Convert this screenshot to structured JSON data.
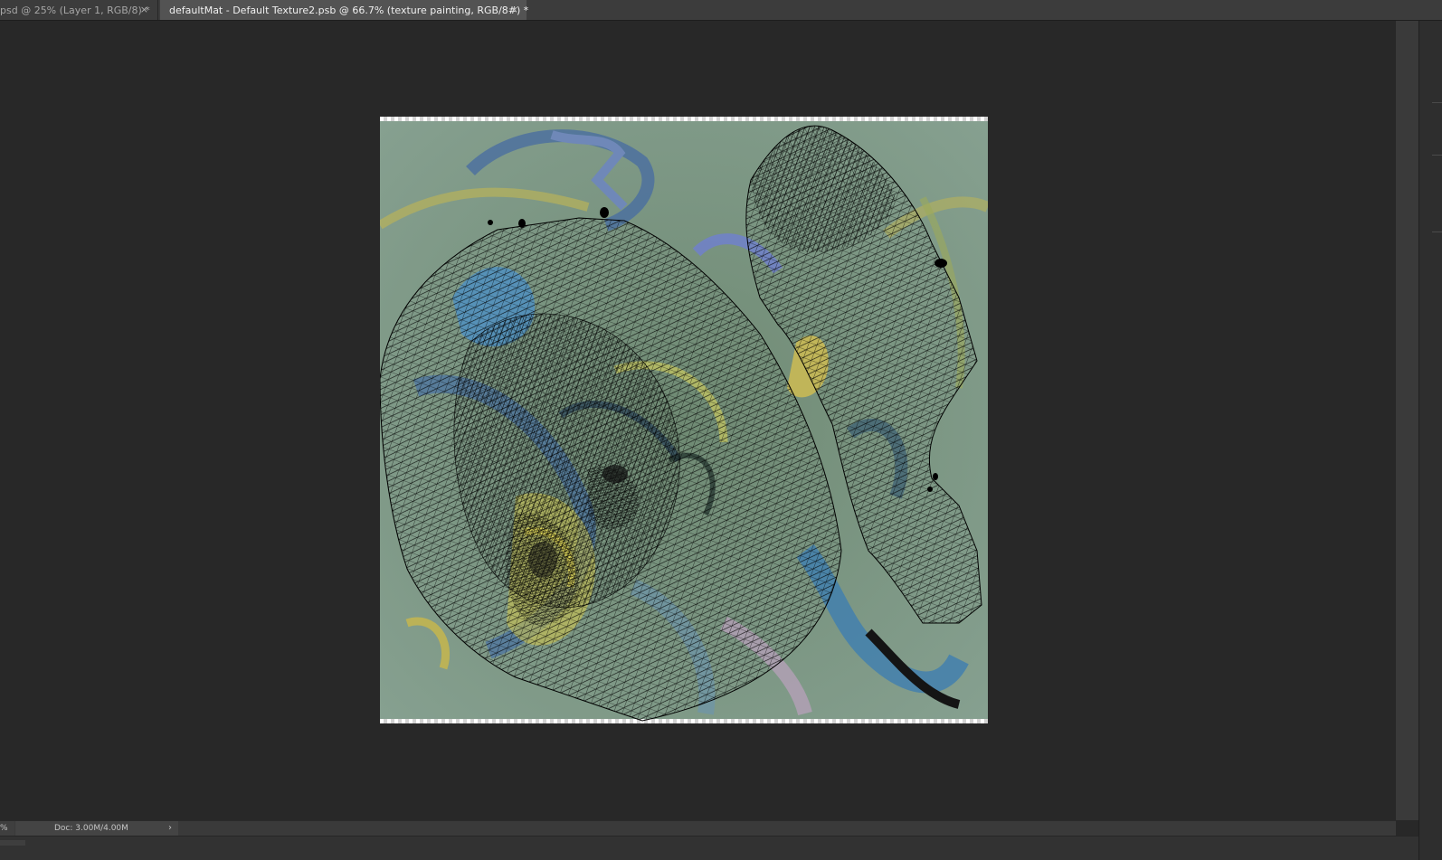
{
  "tabs": [
    {
      "label": "psd @ 25% (Layer 1, RGB/8) *",
      "active": false,
      "close": "×"
    },
    {
      "label": "defaultMat - Default Texture2.psb @ 66.7% (texture painting, RGB/8#) *",
      "active": true,
      "close": "×"
    }
  ],
  "status": {
    "zoom": "%",
    "doc": "Doc: 3.00M/4.00M",
    "arrow": "›"
  },
  "colors": {
    "workspace": "#282828",
    "tab_active": "#535353",
    "tab_inactive": "#3c3c3c",
    "canvas_base": "#7d9584",
    "wireframe": "#000000"
  },
  "canvas": {
    "content": "texture-painting-with-uv-wireframe"
  }
}
